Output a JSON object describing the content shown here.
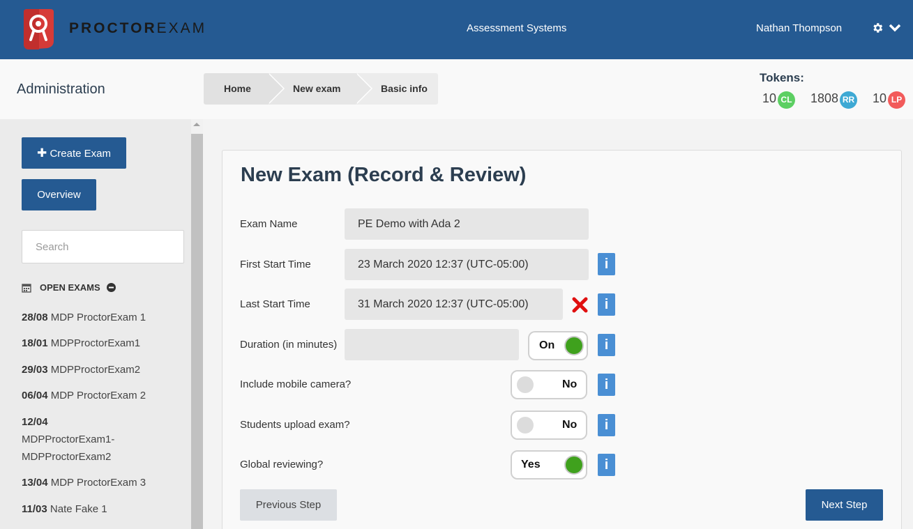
{
  "header": {
    "brand_bold": "PROCTOR",
    "brand_light": "EXAM",
    "org": "Assessment Systems",
    "user": "Nathan Thompson",
    "settings_icon": "gear-icon",
    "dropdown_icon": "chevron-down-icon",
    "color": "#255a92"
  },
  "subheader": {
    "title": "Administration",
    "breadcrumbs": [
      "Home",
      "New exam",
      "Basic info"
    ],
    "tokens_label": "Tokens:",
    "tokens": [
      {
        "count": "10",
        "code": "CL",
        "color": "#5ccf62"
      },
      {
        "count": "1808",
        "code": "RR",
        "color": "#3ea9d4"
      },
      {
        "count": "10",
        "code": "LP",
        "color": "#f25b5b"
      }
    ]
  },
  "sidebar": {
    "create_label": "Create Exam",
    "overview_label": "Overview",
    "search_placeholder": "Search",
    "section_title": "OPEN EXAMS",
    "exams": [
      {
        "date": "28/08",
        "name": "MDP ProctorExam 1"
      },
      {
        "date": "18/01",
        "name": "MDPProctorExam1"
      },
      {
        "date": "29/03",
        "name": "MDPProctorExam2"
      },
      {
        "date": "06/04",
        "name": "MDP ProctorExam 2"
      },
      {
        "date": "12/04",
        "name_line1": "MDPProctorExam1-",
        "name_line2": "MDPProctorExam2"
      },
      {
        "date": "13/04",
        "name": "MDP ProctorExam 3"
      },
      {
        "date": "11/03",
        "name": "Nate Fake 1"
      }
    ]
  },
  "form": {
    "title": "New Exam (Record & Review)",
    "exam_name_label": "Exam Name",
    "exam_name_value": "PE Demo with Ada 2",
    "first_start_label": "First Start Time",
    "first_start_value": "23 March 2020 12:37 (UTC-05:00)",
    "last_start_label": "Last Start Time",
    "last_start_value": "31 March 2020 12:37 (UTC-05:00)",
    "duration_label": "Duration (in minutes)",
    "duration_value": "",
    "duration_toggle": "On",
    "mobile_label": "Include mobile camera?",
    "mobile_toggle": "No",
    "upload_label": "Students upload exam?",
    "upload_toggle": "No",
    "global_label": "Global reviewing?",
    "global_toggle": "Yes",
    "info_glyph": "i",
    "prev_label": "Previous Step",
    "next_label": "Next Step"
  }
}
